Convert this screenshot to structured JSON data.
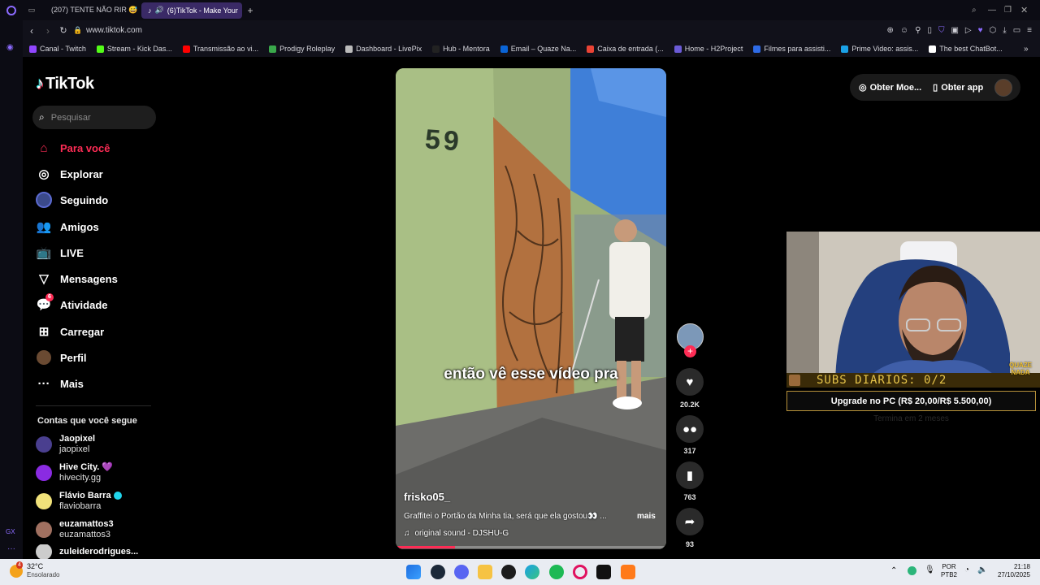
{
  "browser": {
    "tabs": [
      {
        "title": "(207) TENTE NÃO RIR 😅",
        "active": false
      },
      {
        "title": "(6)TikTok - Make Your",
        "active": true
      }
    ],
    "new_tab": "+",
    "url": "www.tiktok.com",
    "bookmarks": [
      {
        "label": "Canal - Twitch",
        "color": "#9146ff"
      },
      {
        "label": "Stream - Kick Das...",
        "color": "#53fc18"
      },
      {
        "label": "Transmissão ao vi...",
        "color": "#ff0000"
      },
      {
        "label": "Prodigy Roleplay",
        "color": "#3aa84b"
      },
      {
        "label": "Dashboard - LivePix",
        "color": "#bbbbbb"
      },
      {
        "label": "Hub - Mentora",
        "color": "#222222"
      },
      {
        "label": "Email – Quaze Na...",
        "color": "#0a64d6"
      },
      {
        "label": "Caixa de entrada (...",
        "color": "#ea4335"
      },
      {
        "label": "Home - H2Project",
        "color": "#6b5bd6"
      },
      {
        "label": "Filmes para assisti...",
        "color": "#2e6be6"
      },
      {
        "label": "Prime Video: assis...",
        "color": "#1aa1e6"
      },
      {
        "label": "The best ChatBot...",
        "color": "#ffffff"
      }
    ]
  },
  "tiktok": {
    "logo": "TikTok",
    "search_placeholder": "Pesquisar",
    "nav": [
      {
        "label": "Para você",
        "icon": "home-icon",
        "active": true
      },
      {
        "label": "Explorar",
        "icon": "compass-icon"
      },
      {
        "label": "Seguindo",
        "icon": "following-avatar-icon"
      },
      {
        "label": "Amigos",
        "icon": "friends-icon"
      },
      {
        "label": "LIVE",
        "icon": "live-icon"
      },
      {
        "label": "Mensagens",
        "icon": "send-icon"
      },
      {
        "label": "Atividade",
        "icon": "activity-icon",
        "badge": "6"
      },
      {
        "label": "Carregar",
        "icon": "upload-icon"
      },
      {
        "label": "Perfil",
        "icon": "profile-avatar-icon"
      },
      {
        "label": "Mais",
        "icon": "more-icon"
      }
    ],
    "following_header": "Contas que você segue",
    "following": [
      {
        "name": "Jaopixel",
        "handle": "jaopixel",
        "color": "#4a3f8f"
      },
      {
        "name": "Hive City. 💜",
        "handle": "hivecity.gg",
        "color": "#8a2be2"
      },
      {
        "name": "Flávio Barra",
        "handle": "flaviobarra",
        "verified": true,
        "color": "#f1e27a"
      },
      {
        "name": "euzamattos3",
        "handle": "euzamattos3",
        "color": "#a07060"
      },
      {
        "name": "zuleiderodrigues...",
        "handle": "",
        "color": "#cccccc"
      }
    ],
    "header_buttons": {
      "coins": "Obter Moe...",
      "app": "Obter app"
    },
    "video": {
      "caption_overlay": "então vê esse vídeo pra",
      "house_number": "59",
      "author": "frisko05_",
      "description": "Graffitei o Portão da Minha tia, será que ela gostou👀 ...",
      "more": "mais",
      "sound": "original sound - DJSHU-G",
      "likes": "20.2K",
      "comments": "317",
      "saves": "763",
      "shares": "93",
      "progress": 0.22
    }
  },
  "stream_overlay": {
    "subs": "SUBS DIARIOS: 0/2",
    "brand": "QUAZE NADA",
    "upgrade": "Upgrade no PC (R$ 20,00/R$ 5.500,00)",
    "ends": "Termina em 2 meses"
  },
  "taskbar": {
    "weather_temp": "32°C",
    "weather_text": "Ensolarado",
    "weather_badge": "4",
    "lang": "POR",
    "layout": "PTB2",
    "time": "21:18",
    "date": "27/10/2025"
  }
}
